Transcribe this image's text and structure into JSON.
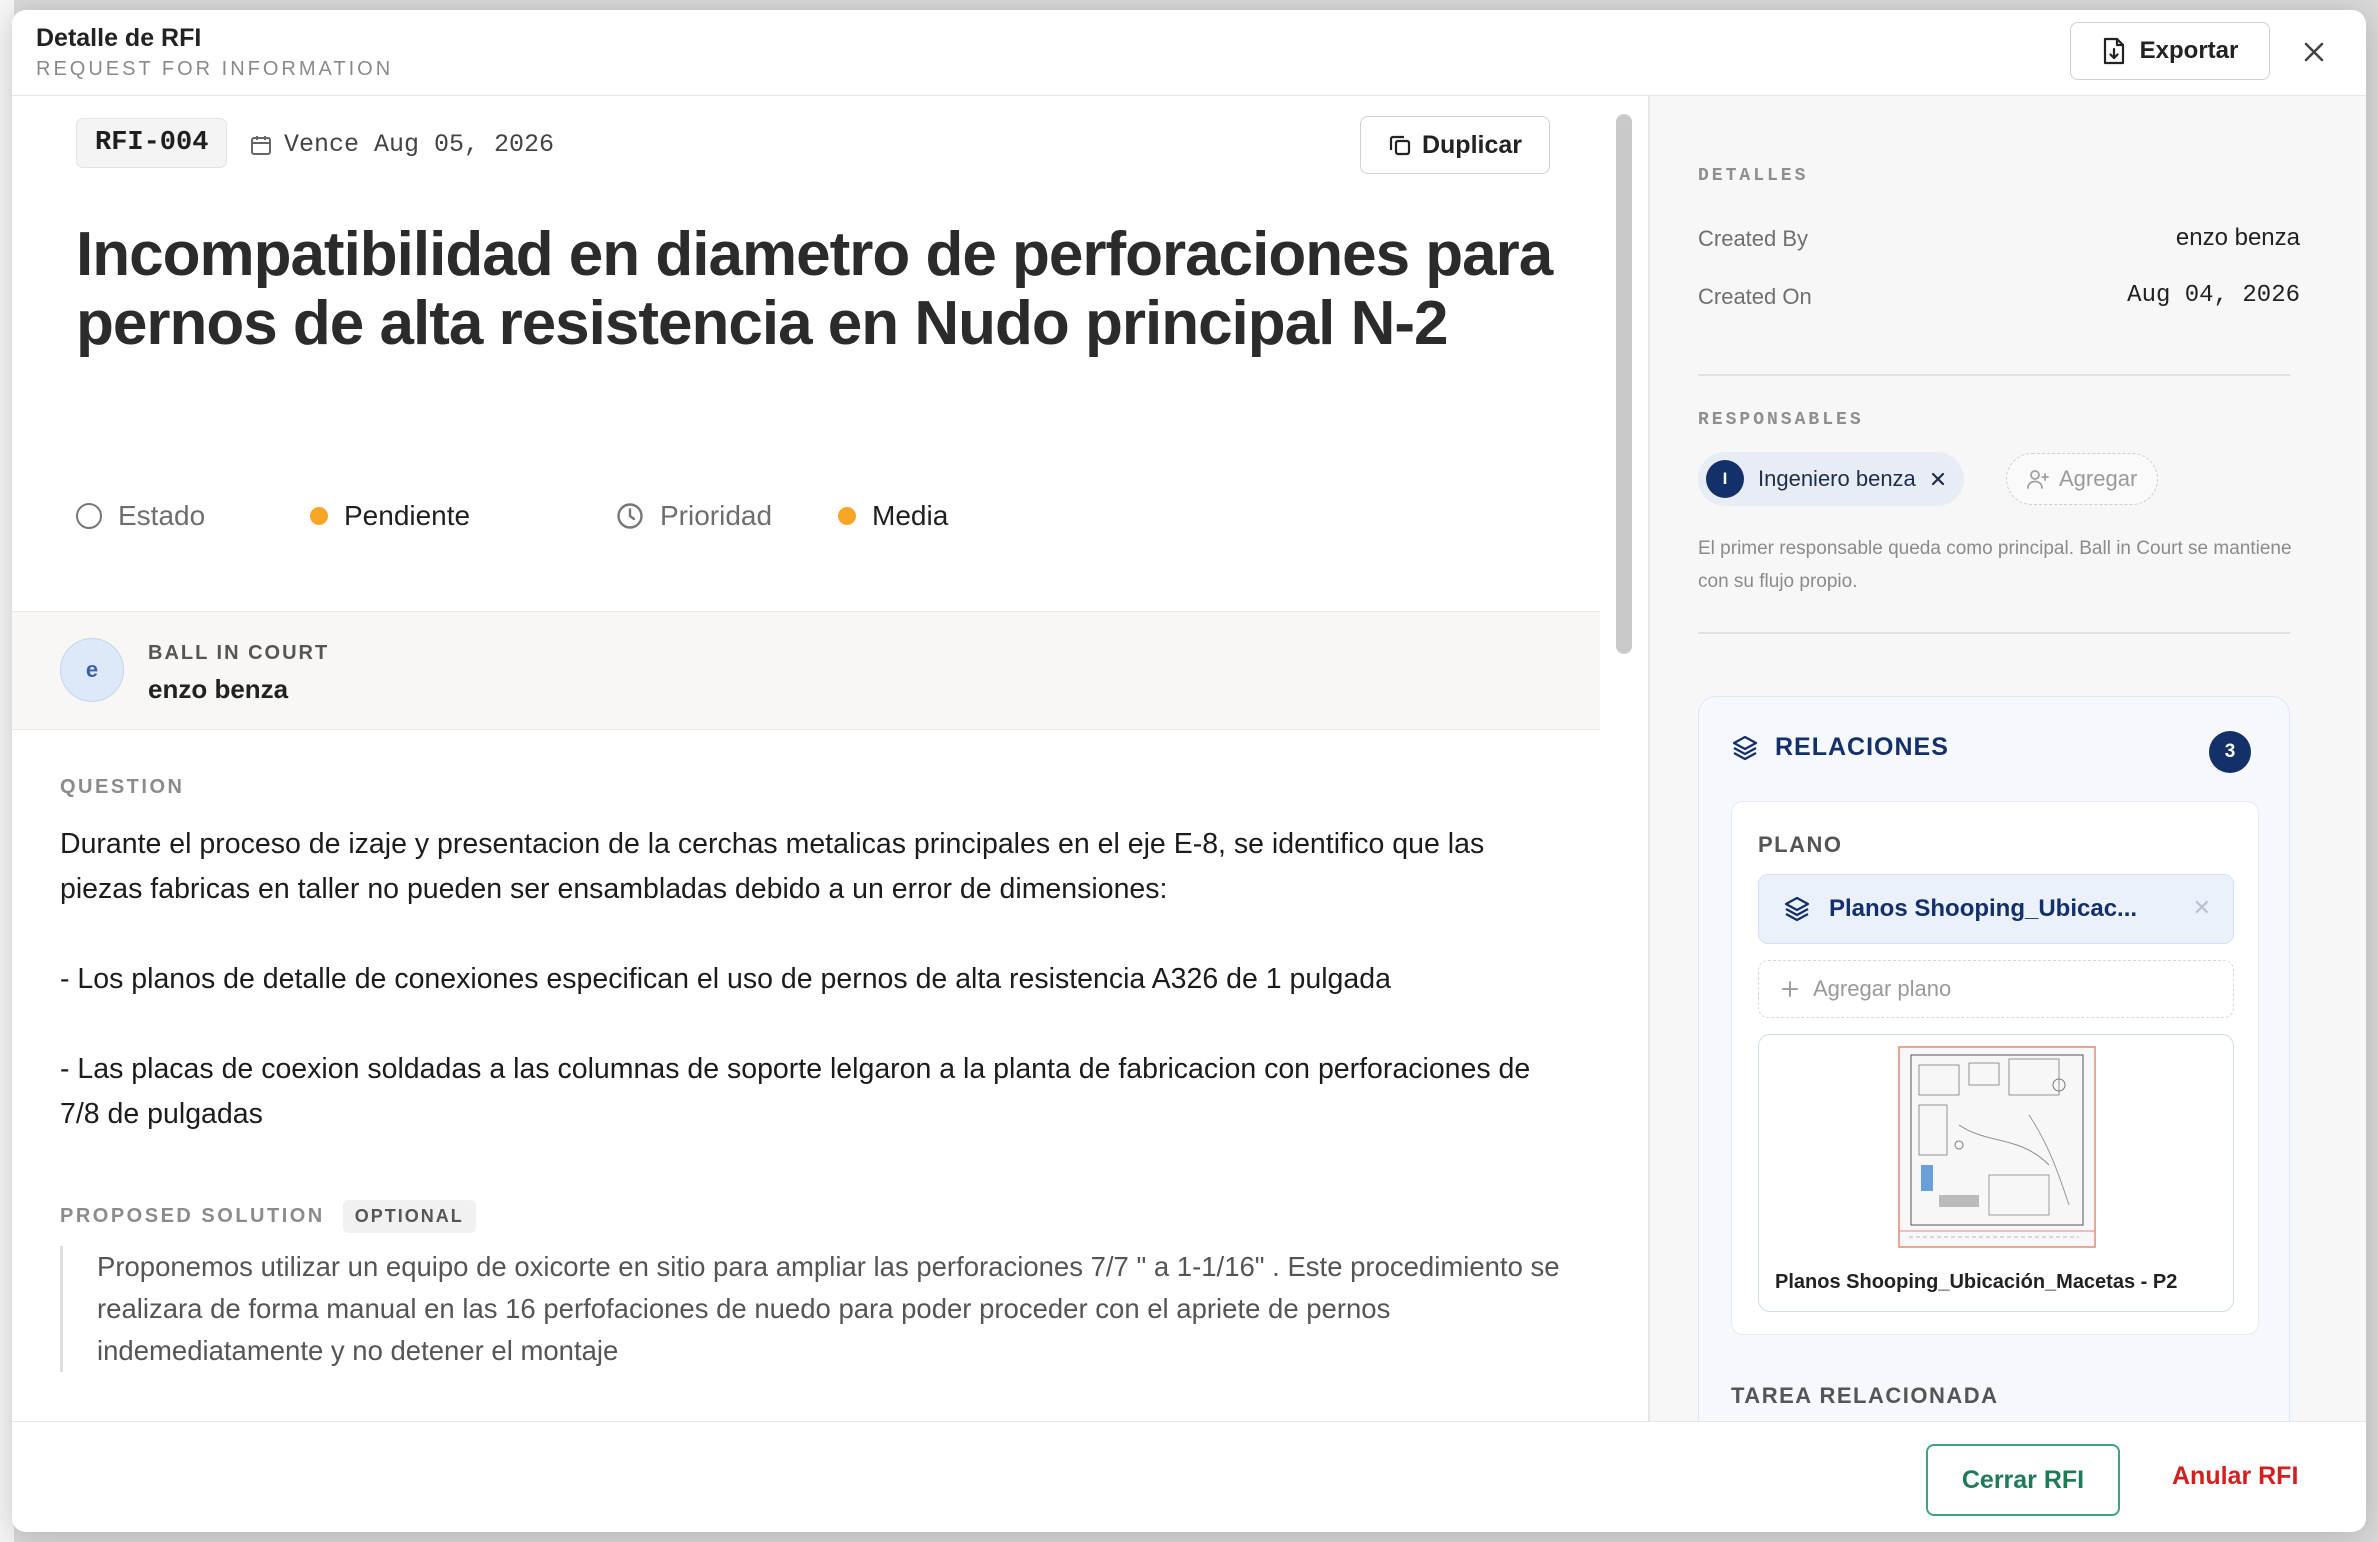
{
  "modal": {
    "title": "Detalle de RFI",
    "subtitle": "REQUEST FOR INFORMATION",
    "export_label": "Exportar"
  },
  "rfi": {
    "id": "RFI-004",
    "due": "Vence Aug 05, 2026",
    "duplicate_label": "Duplicar",
    "title": "Incompatibilidad en diametro de perforaciones para pernos de alta resistencia en Nudo principal N-2",
    "status_label": "Estado",
    "status_value": "Pendiente",
    "priority_label": "Prioridad",
    "priority_value": "Media",
    "status_color": "#f5a623",
    "priority_color": "#f5a623"
  },
  "ball_in_court": {
    "label": "BALL IN COURT",
    "initial": "e",
    "name": "enzo benza"
  },
  "question": {
    "label": "QUESTION",
    "paragraphs": [
      "Durante el proceso de izaje y presentacion de la cerchas metalicas principales en el eje E-8, se identifico que las piezas fabricas en taller no pueden ser ensambladas debido a un error de dimensiones:",
      "- Los planos de detalle de conexiones especifican el uso de pernos de alta resistencia A326 de 1 pulgada",
      "- Las placas de coexion soldadas a las columnas de soporte lelgaron a la planta de fabricacion con perforaciones de 7/8 de pulgadas"
    ]
  },
  "proposed_solution": {
    "label": "PROPOSED SOLUTION",
    "badge": "OPTIONAL",
    "text": "Proponemos utilizar un equipo de oxicorte en sitio para ampliar las perforaciones 7/7 \" a 1-1/16\" . Este procedimiento se realizara de forma manual en las 16 perfofaciones de nuedo para poder proceder con el apriete de pernos indemediatamente y no detener el montaje"
  },
  "details": {
    "label": "DETALLES",
    "created_by_label": "Created By",
    "created_by": "enzo benza",
    "created_on_label": "Created On",
    "created_on": "Aug 04, 2026"
  },
  "responsables": {
    "label": "RESPONSABLES",
    "chips": [
      {
        "initial": "I",
        "name": "Ingeniero benza"
      }
    ],
    "add_label": "Agregar",
    "hint": "El primer responsable queda como principal. Ball in Court se mantiene con su flujo propio."
  },
  "relaciones": {
    "label": "RELACIONES",
    "count": "3",
    "plano_label": "PLANO",
    "plano_item": "Planos Shooping_Ubicac...",
    "add_plano": "Agregar plano",
    "thumb_caption": "Planos Shooping_Ubicación_Macetas - P2",
    "tarea_label": "TAREA RELACIONADA"
  },
  "footer": {
    "close_label": "Cerrar RFI",
    "void_label": "Anular RFI"
  },
  "icons": {
    "export": "file-download-icon",
    "close": "close-icon",
    "calendar": "calendar-icon",
    "duplicate": "copy-icon",
    "layers": "layers-icon",
    "add_user": "user-plus-icon",
    "plus": "plus-icon"
  }
}
